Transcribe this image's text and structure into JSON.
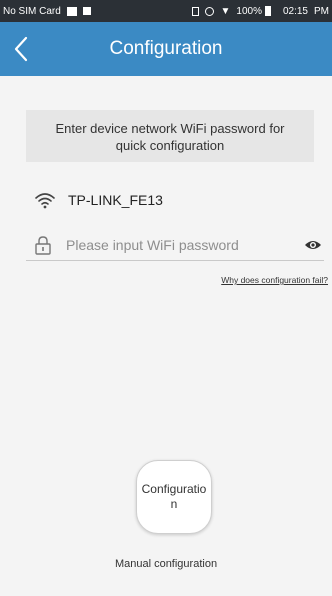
{
  "status_bar": {
    "carrier": "No SIM Card",
    "battery": "100%",
    "time": "02:15",
    "time_suffix": "PM"
  },
  "header": {
    "title": "Configuration",
    "background": "#3b8ac4",
    "back_icon": "chevron-left-icon"
  },
  "instruction": {
    "line1": "Enter device network WiFi password for",
    "line2": "quick configuration"
  },
  "network": {
    "icon": "wifi-icon",
    "ssid": "TP-LINK_FE13"
  },
  "password": {
    "icon": "lock-icon",
    "placeholder": "Please input WiFi password",
    "value": "",
    "toggle_icon": "eye-icon"
  },
  "help_link": "Why does configuration fail?",
  "configure_button": {
    "label_line1": "Configuratio",
    "label_line2": "n"
  },
  "manual_link": "Manual configuration"
}
